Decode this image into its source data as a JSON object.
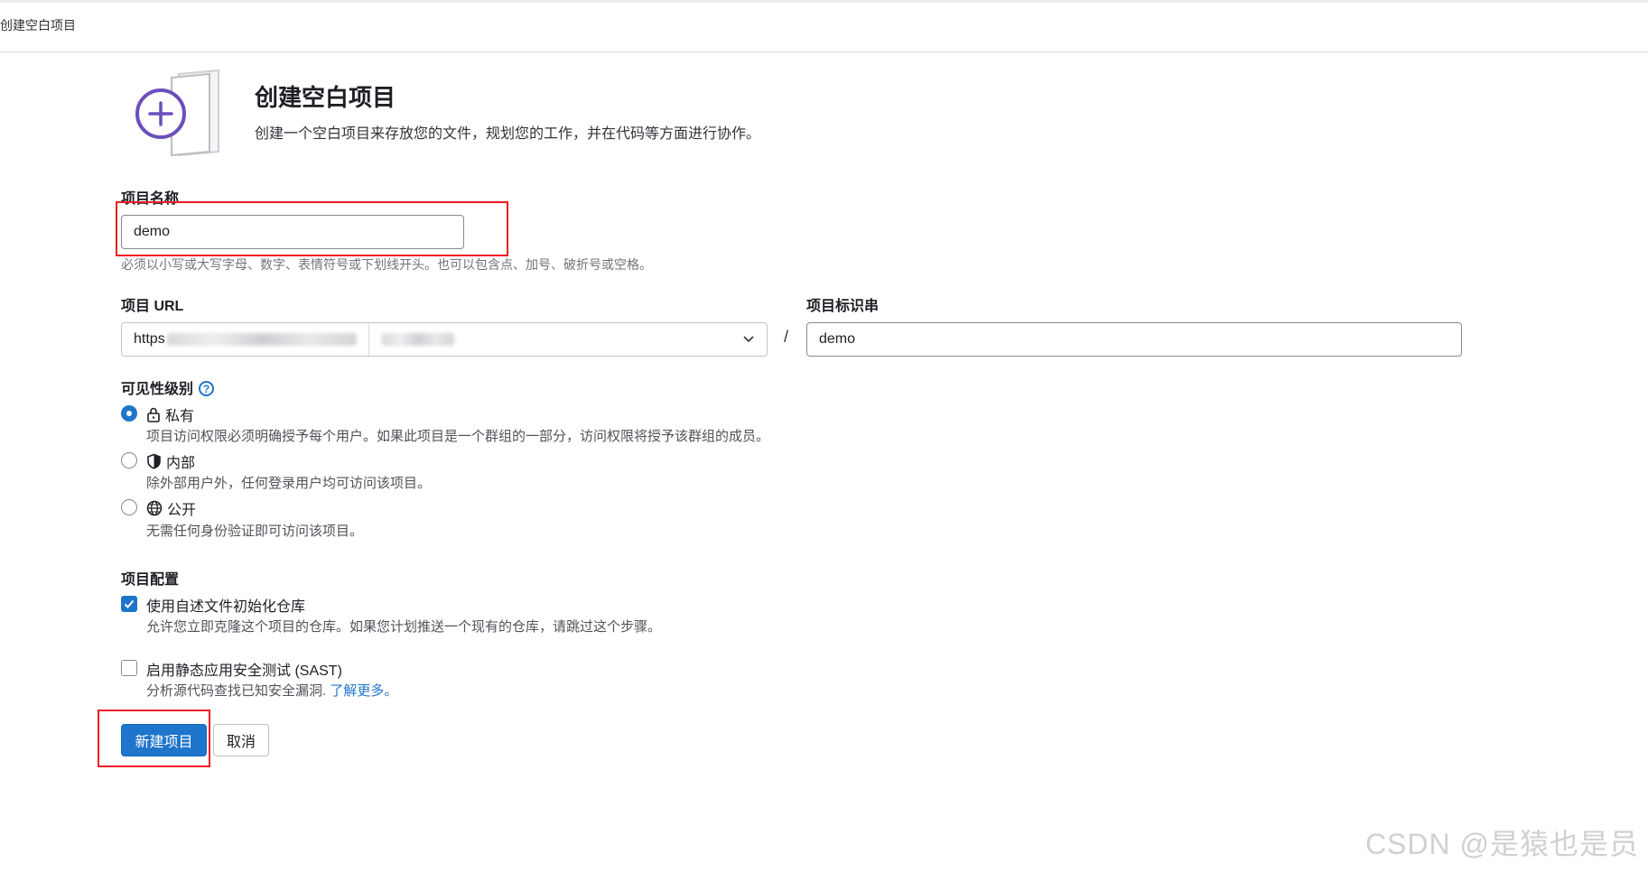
{
  "breadcrumb": {
    "current": "创建空白项目"
  },
  "header": {
    "title": "创建空白项目",
    "description": "创建一个空白项目来存放您的文件，规划您的工作，并在代码等方面进行协作。"
  },
  "project_name": {
    "label": "项目名称",
    "value": "demo",
    "hint": "必须以小写或大写字母、数字、表情符号或下划线开头。也可以包含点、加号、破折号或空格。"
  },
  "project_url": {
    "label": "项目 URL",
    "prefix_visible": "https",
    "separator": "/"
  },
  "project_slug": {
    "label": "项目标识串",
    "value": "demo"
  },
  "visibility": {
    "label": "可见性级别",
    "help_icon": "question-circle-icon",
    "options": [
      {
        "title": "私有",
        "icon": "lock-icon",
        "description": "项目访问权限必须明确授予每个用户。如果此项目是一个群组的一部分，访问权限将授予该群组的成员。",
        "checked": true
      },
      {
        "title": "内部",
        "icon": "shield-icon",
        "description": "除外部用户外，任何登录用户均可访问该项目。",
        "checked": false
      },
      {
        "title": "公开",
        "icon": "globe-icon",
        "description": "无需任何身份验证即可访问该项目。",
        "checked": false
      }
    ]
  },
  "config": {
    "label": "项目配置",
    "readme": {
      "label": "使用自述文件初始化仓库",
      "description": "允许您立即克隆这个项目的仓库。如果您计划推送一个现有的仓库，请跳过这个步骤。",
      "checked": true
    },
    "sast": {
      "label": "启用静态应用安全测试 (SAST)",
      "description": "分析源代码查找已知安全漏洞.",
      "link": "了解更多。",
      "checked": false
    }
  },
  "actions": {
    "create": "新建项目",
    "cancel": "取消"
  },
  "watermark": "CSDN @是猿也是员",
  "colors": {
    "primary": "#1f75cb",
    "highlight": "#ee1c25"
  }
}
